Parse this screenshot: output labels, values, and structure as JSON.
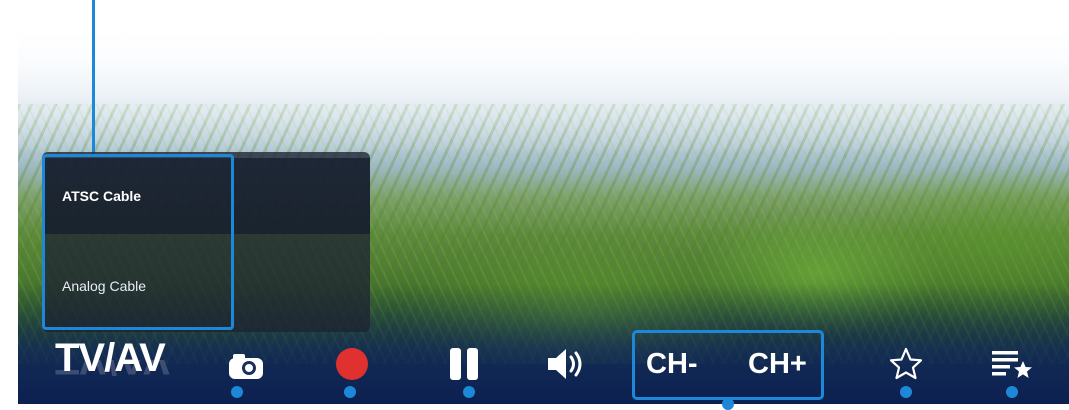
{
  "player": {
    "source_button": "TV/AV",
    "source_menu": {
      "items": [
        {
          "label": "ATSC Cable",
          "selected": true
        },
        {
          "label": "Analog Cable",
          "selected": false
        }
      ]
    },
    "controls": {
      "snapshot_icon": "camera-icon",
      "record_icon": "record-icon",
      "pause_icon": "pause-icon",
      "volume_icon": "volume-icon",
      "channel_down_label": "CH-",
      "channel_up_label": "CH+",
      "favorite_icon": "star-icon",
      "favorites_list_icon": "favorites-list-icon"
    }
  },
  "colors": {
    "accent": "#1e88d8",
    "record": "#e03030",
    "text": "#ffffff"
  }
}
